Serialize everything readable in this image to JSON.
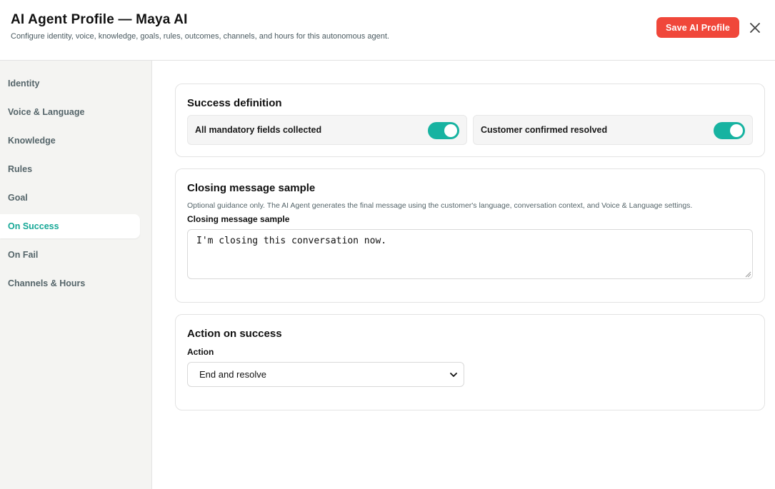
{
  "header": {
    "title": "AI Agent Profile — Maya AI",
    "subtitle": "Configure identity, voice, knowledge, goals, rules, outcomes, channels, and hours for this autonomous agent.",
    "save_label": "Save AI Profile",
    "close_icon": "close-icon"
  },
  "sidebar": {
    "items": [
      {
        "label": "Identity"
      },
      {
        "label": "Voice & Language"
      },
      {
        "label": "Knowledge"
      },
      {
        "label": "Rules"
      },
      {
        "label": "Goal"
      },
      {
        "label": "On Success"
      },
      {
        "label": "On Fail"
      },
      {
        "label": "Channels & Hours"
      }
    ],
    "active_label": "On Success"
  },
  "success_definition": {
    "title": "Success definition",
    "toggles": [
      {
        "label": "All mandatory fields collected",
        "on": true
      },
      {
        "label": "Customer confirmed resolved",
        "on": true
      }
    ]
  },
  "closing_message": {
    "title": "Closing message sample",
    "helper": "Optional guidance only. The AI Agent generates the final message using the customer's language, conversation context, and Voice & Language settings.",
    "field_label": "Closing message sample",
    "value": "I'm closing this conversation now."
  },
  "action_on_success": {
    "title": "Action on success",
    "field_label": "Action",
    "selected": "End and resolve"
  },
  "colors": {
    "accent": "#17b3a1",
    "accent_text": "#17a897",
    "save_button": "#f0473a"
  }
}
